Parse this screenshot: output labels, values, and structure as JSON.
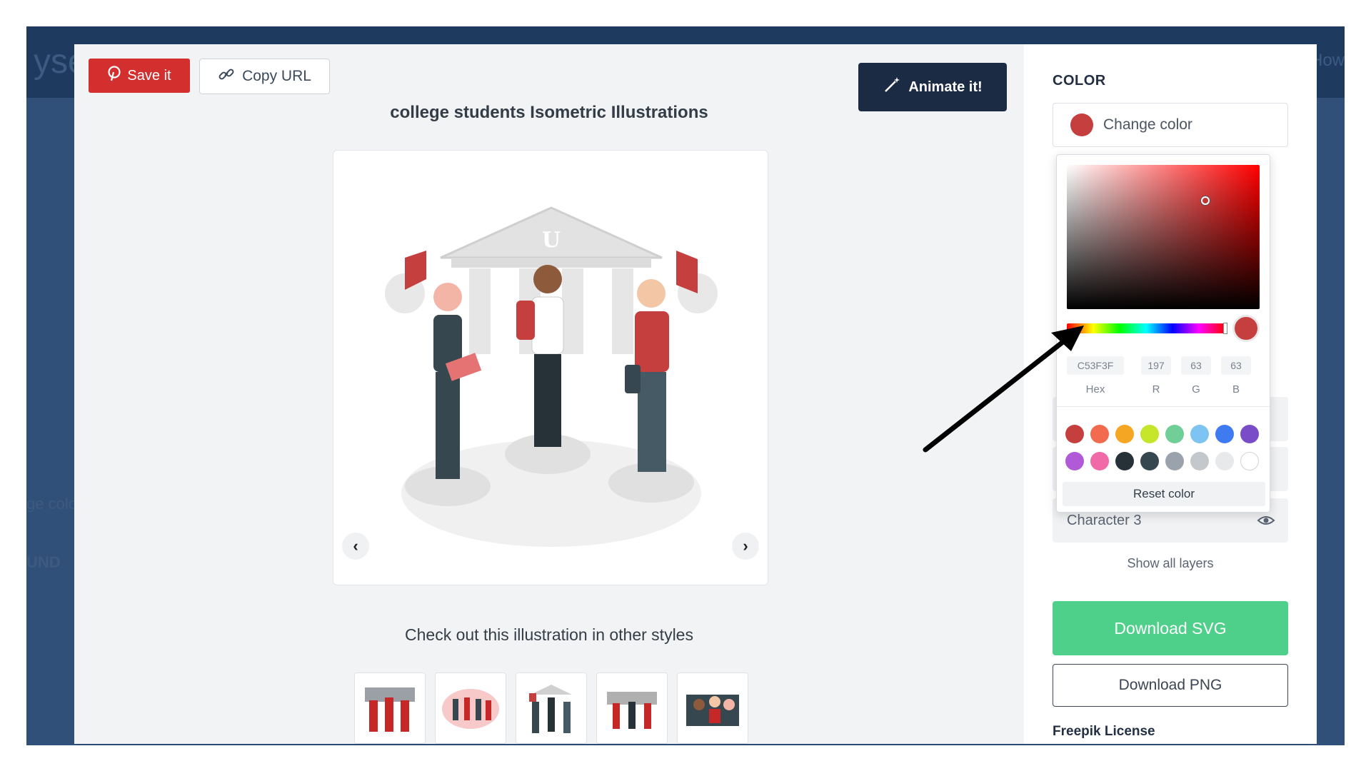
{
  "background": {
    "left_text": "yse",
    "right_text": "How",
    "ghost_labels": [
      "ge colo",
      "UND"
    ]
  },
  "toolbar": {
    "save_label": "Save it",
    "copy_label": "Copy URL",
    "animate_label": "Animate it!"
  },
  "main": {
    "title": "college students Isometric Illustrations",
    "other_styles_heading": "Check out this illustration in other styles",
    "prev_label": "‹",
    "next_label": "›"
  },
  "panel": {
    "color_heading": "COLOR",
    "change_color_label": "Change color",
    "current_color": "#c53f3f",
    "layers": [
      {
        "label": "Character 3"
      }
    ],
    "show_layers_label": "Show all layers",
    "download_svg_label": "Download SVG",
    "download_png_label": "Download PNG",
    "license_label": "Freepik License"
  },
  "picker": {
    "hex": "C53F3F",
    "r": "197",
    "g": "63",
    "b": "63",
    "labels": {
      "hex": "Hex",
      "r": "R",
      "g": "G",
      "b": "B"
    },
    "palette": [
      "#c53f3f",
      "#f26b4f",
      "#f5a623",
      "#c6e62b",
      "#6fcf97",
      "#7ec4f2",
      "#3f7bf0",
      "#7b4cc8",
      "#b05ad8",
      "#f06aa8",
      "#263238",
      "#37474f",
      "#9aa3ab",
      "#c3c8cd",
      "#e7e9eb",
      "#ffffff"
    ],
    "reset_label": "Reset color"
  },
  "colors": {
    "accent_red": "#d32f2f",
    "navy": "#1b2b44",
    "green": "#4fd08a"
  }
}
